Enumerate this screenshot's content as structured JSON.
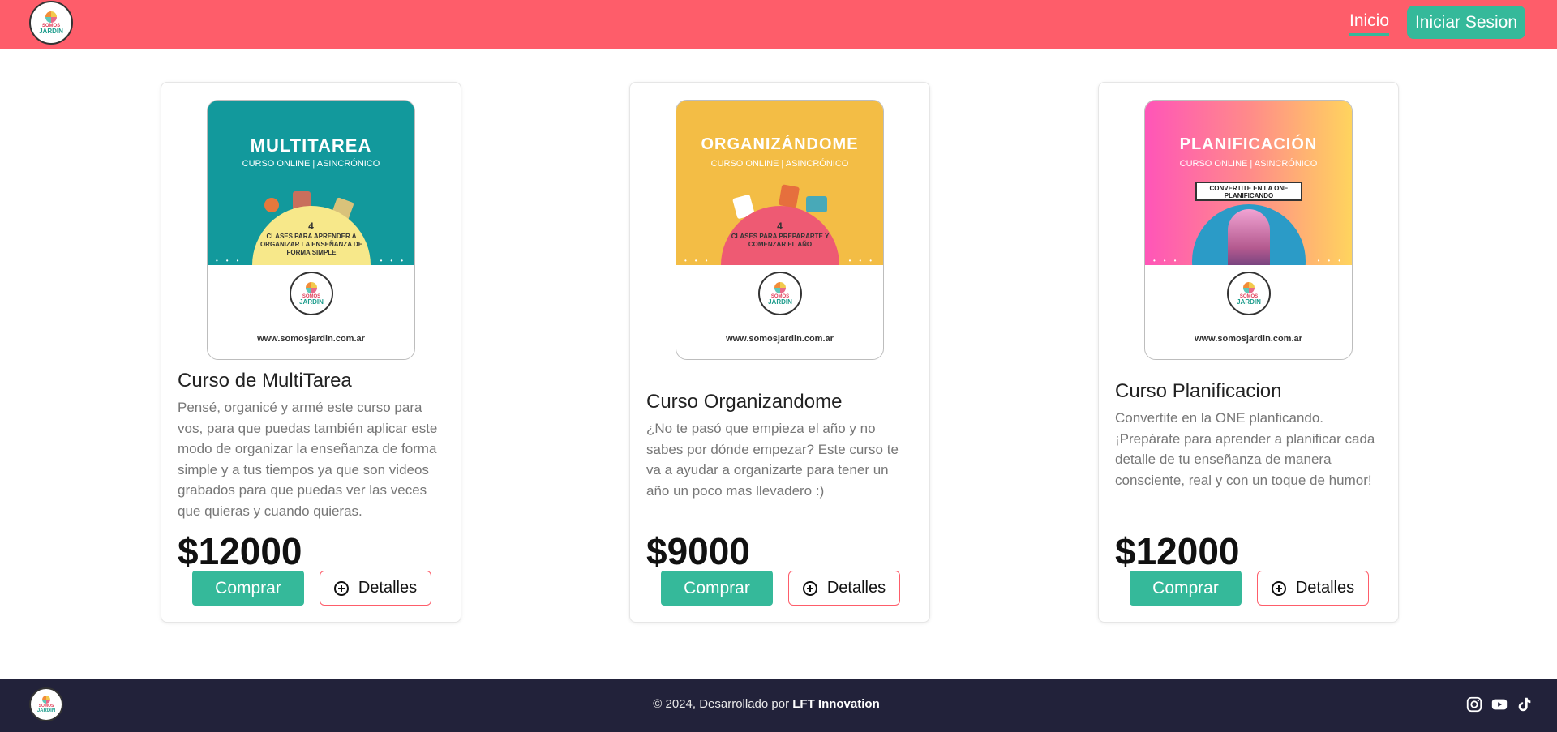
{
  "header": {
    "logo_text_top": "SOMOS",
    "logo_text_bottom": "JARDIN",
    "nav_inicio": "Inicio",
    "login_button": "Iniciar Sesion"
  },
  "colors": {
    "header_bg": "#fe5d6a",
    "accent_green": "#35b99a",
    "footer_bg": "#22223a"
  },
  "cards": [
    {
      "cover_title": "MULTITAREA",
      "cover_subtitle": "CURSO ONLINE  |  ASINCRÓNICO",
      "cover_number": "4",
      "cover_caption": "CLASES PARA APRENDER A ORGANIZAR LA ENSEÑANZA DE FORMA SIMPLE",
      "cover_url": "www.somosjardin.com.ar",
      "title": "Curso de MultiTarea",
      "description": "Pensé, organicé y armé este curso para vos, para que puedas también aplicar este modo de organizar la enseñanza de forma simple y a tus tiempos ya que son videos grabados para que puedas ver las veces que quieras y cuando quieras.",
      "price": "$12000",
      "buy_label": "Comprar",
      "details_label": "Detalles"
    },
    {
      "cover_title": "ORGANIZÁNDOME",
      "cover_subtitle": "CURSO ONLINE  |  ASINCRÓNICO",
      "cover_number": "4",
      "cover_caption": "CLASES PARA PREPARARTE Y COMENZAR EL AÑO",
      "cover_url": "www.somosjardin.com.ar",
      "title": "Curso Organizandome",
      "description": "¿No te pasó que empieza el año y no sabes por dónde empezar? Este curso te va a ayudar a organizarte para tener un año un poco mas llevadero :)",
      "price": "$9000",
      "buy_label": "Comprar",
      "details_label": "Detalles"
    },
    {
      "cover_title": "PLANIFICACIÓN",
      "cover_subtitle": "CURSO ONLINE  |  ASINCRÓNICO",
      "cover_badge": "CONVERTITE EN LA ONE PLANIFICANDO",
      "cover_url": "www.somosjardin.com.ar",
      "title": "Curso Planificacion",
      "description": "Convertite en la ONE planficando. ¡Prepárate para aprender a planificar cada detalle de tu enseñanza de manera consciente, real y con un toque de humor!",
      "price": "$12000",
      "buy_label": "Comprar",
      "details_label": "Detalles"
    }
  ],
  "footer": {
    "copyright_prefix": "© 2024, Desarrollado por ",
    "copyright_company": "LFT Innovation",
    "social_icons": [
      "instagram-icon",
      "youtube-icon",
      "tiktok-icon"
    ]
  }
}
